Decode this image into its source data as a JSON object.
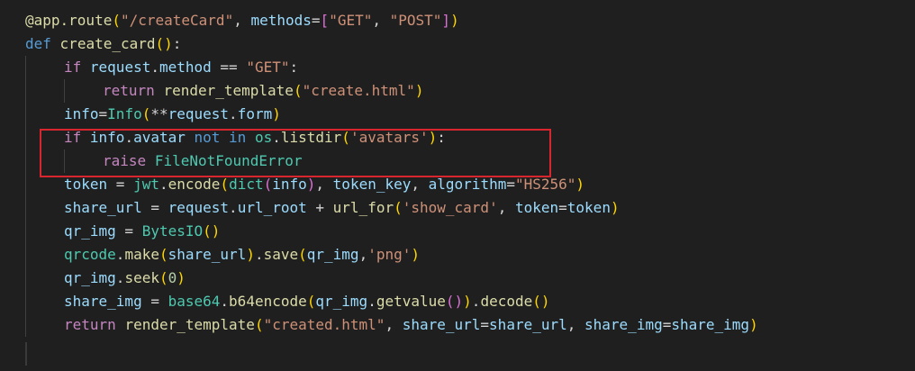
{
  "colors": {
    "background": "#1f1f1f",
    "highlight_box": "#d7262d",
    "default": "#d4d4d4",
    "keyword": "#569cd6",
    "control": "#c586c0",
    "function": "#dcdcaa",
    "string": "#ce9178",
    "variable": "#9cdcfe",
    "class": "#4ec9b0",
    "number": "#b5cea8",
    "bracket1": "#ffd700",
    "bracket2": "#da70d6",
    "bracket3": "#179fff"
  },
  "code_lines": [
    {
      "indent": 0,
      "tokens": [
        {
          "t": "@app.route",
          "c": "function"
        },
        {
          "t": "(",
          "c": "bracket1"
        },
        {
          "t": "\"/createCard\"",
          "c": "string"
        },
        {
          "t": ", ",
          "c": "default"
        },
        {
          "t": "methods",
          "c": "variable"
        },
        {
          "t": "=",
          "c": "default"
        },
        {
          "t": "[",
          "c": "bracket2"
        },
        {
          "t": "\"GET\"",
          "c": "string"
        },
        {
          "t": ", ",
          "c": "default"
        },
        {
          "t": "\"POST\"",
          "c": "string"
        },
        {
          "t": "]",
          "c": "bracket2"
        },
        {
          "t": ")",
          "c": "bracket1"
        }
      ]
    },
    {
      "indent": 0,
      "tokens": [
        {
          "t": "def",
          "c": "keyword"
        },
        {
          "t": " ",
          "c": "default"
        },
        {
          "t": "create_card",
          "c": "function"
        },
        {
          "t": "()",
          "c": "bracket1"
        },
        {
          "t": ":",
          "c": "default"
        }
      ]
    },
    {
      "indent": 1,
      "tokens": [
        {
          "t": "if",
          "c": "control"
        },
        {
          "t": " ",
          "c": "default"
        },
        {
          "t": "request",
          "c": "variable"
        },
        {
          "t": ".",
          "c": "default"
        },
        {
          "t": "method",
          "c": "variable"
        },
        {
          "t": " == ",
          "c": "default"
        },
        {
          "t": "\"GET\"",
          "c": "string"
        },
        {
          "t": ":",
          "c": "default"
        }
      ]
    },
    {
      "indent": 2,
      "tokens": [
        {
          "t": "return",
          "c": "control"
        },
        {
          "t": " ",
          "c": "default"
        },
        {
          "t": "render_template",
          "c": "function"
        },
        {
          "t": "(",
          "c": "bracket1"
        },
        {
          "t": "\"create.html\"",
          "c": "string"
        },
        {
          "t": ")",
          "c": "bracket1"
        }
      ]
    },
    {
      "indent": 1,
      "tokens": [
        {
          "t": "info",
          "c": "variable"
        },
        {
          "t": "=",
          "c": "default"
        },
        {
          "t": "Info",
          "c": "class"
        },
        {
          "t": "(",
          "c": "bracket1"
        },
        {
          "t": "**",
          "c": "default"
        },
        {
          "t": "request",
          "c": "variable"
        },
        {
          "t": ".",
          "c": "default"
        },
        {
          "t": "form",
          "c": "variable"
        },
        {
          "t": ")",
          "c": "bracket1"
        }
      ]
    },
    {
      "indent": 1,
      "tokens": [
        {
          "t": "if",
          "c": "control"
        },
        {
          "t": " ",
          "c": "default"
        },
        {
          "t": "info",
          "c": "variable"
        },
        {
          "t": ".",
          "c": "default"
        },
        {
          "t": "avatar",
          "c": "variable"
        },
        {
          "t": " ",
          "c": "default"
        },
        {
          "t": "not in",
          "c": "keyword"
        },
        {
          "t": " ",
          "c": "default"
        },
        {
          "t": "os",
          "c": "class"
        },
        {
          "t": ".",
          "c": "default"
        },
        {
          "t": "listdir",
          "c": "function"
        },
        {
          "t": "(",
          "c": "bracket1"
        },
        {
          "t": "'avatars'",
          "c": "string"
        },
        {
          "t": ")",
          "c": "bracket1"
        },
        {
          "t": ":",
          "c": "default"
        }
      ]
    },
    {
      "indent": 2,
      "tokens": [
        {
          "t": "raise",
          "c": "control"
        },
        {
          "t": " ",
          "c": "default"
        },
        {
          "t": "FileNotFoundError",
          "c": "class"
        }
      ]
    },
    {
      "indent": 1,
      "tokens": [
        {
          "t": "token",
          "c": "variable"
        },
        {
          "t": " = ",
          "c": "default"
        },
        {
          "t": "jwt",
          "c": "class"
        },
        {
          "t": ".",
          "c": "default"
        },
        {
          "t": "encode",
          "c": "function"
        },
        {
          "t": "(",
          "c": "bracket1"
        },
        {
          "t": "dict",
          "c": "class"
        },
        {
          "t": "(",
          "c": "bracket2"
        },
        {
          "t": "info",
          "c": "variable"
        },
        {
          "t": ")",
          "c": "bracket2"
        },
        {
          "t": ", ",
          "c": "default"
        },
        {
          "t": "token_key",
          "c": "variable"
        },
        {
          "t": ", ",
          "c": "default"
        },
        {
          "t": "algorithm",
          "c": "variable"
        },
        {
          "t": "=",
          "c": "default"
        },
        {
          "t": "\"HS256\"",
          "c": "string"
        },
        {
          "t": ")",
          "c": "bracket1"
        }
      ]
    },
    {
      "indent": 1,
      "tokens": [
        {
          "t": "share_url",
          "c": "variable"
        },
        {
          "t": " = ",
          "c": "default"
        },
        {
          "t": "request",
          "c": "variable"
        },
        {
          "t": ".",
          "c": "default"
        },
        {
          "t": "url_root",
          "c": "variable"
        },
        {
          "t": " + ",
          "c": "default"
        },
        {
          "t": "url_for",
          "c": "function"
        },
        {
          "t": "(",
          "c": "bracket1"
        },
        {
          "t": "'show_card'",
          "c": "string"
        },
        {
          "t": ", ",
          "c": "default"
        },
        {
          "t": "token",
          "c": "variable"
        },
        {
          "t": "=",
          "c": "default"
        },
        {
          "t": "token",
          "c": "variable"
        },
        {
          "t": ")",
          "c": "bracket1"
        }
      ]
    },
    {
      "indent": 1,
      "tokens": [
        {
          "t": "qr_img",
          "c": "variable"
        },
        {
          "t": " = ",
          "c": "default"
        },
        {
          "t": "BytesIO",
          "c": "class"
        },
        {
          "t": "()",
          "c": "bracket1"
        }
      ]
    },
    {
      "indent": 1,
      "tokens": [
        {
          "t": "qrcode",
          "c": "class"
        },
        {
          "t": ".",
          "c": "default"
        },
        {
          "t": "make",
          "c": "function"
        },
        {
          "t": "(",
          "c": "bracket1"
        },
        {
          "t": "share_url",
          "c": "variable"
        },
        {
          "t": ")",
          "c": "bracket1"
        },
        {
          "t": ".",
          "c": "default"
        },
        {
          "t": "save",
          "c": "function"
        },
        {
          "t": "(",
          "c": "bracket1"
        },
        {
          "t": "qr_img",
          "c": "variable"
        },
        {
          "t": ",",
          "c": "default"
        },
        {
          "t": "'png'",
          "c": "string"
        },
        {
          "t": ")",
          "c": "bracket1"
        }
      ]
    },
    {
      "indent": 1,
      "tokens": [
        {
          "t": "qr_img",
          "c": "variable"
        },
        {
          "t": ".",
          "c": "default"
        },
        {
          "t": "seek",
          "c": "function"
        },
        {
          "t": "(",
          "c": "bracket1"
        },
        {
          "t": "0",
          "c": "number"
        },
        {
          "t": ")",
          "c": "bracket1"
        }
      ]
    },
    {
      "indent": 1,
      "tokens": [
        {
          "t": "share_img",
          "c": "variable"
        },
        {
          "t": " = ",
          "c": "default"
        },
        {
          "t": "base64",
          "c": "class"
        },
        {
          "t": ".",
          "c": "default"
        },
        {
          "t": "b64encode",
          "c": "function"
        },
        {
          "t": "(",
          "c": "bracket1"
        },
        {
          "t": "qr_img",
          "c": "variable"
        },
        {
          "t": ".",
          "c": "default"
        },
        {
          "t": "getvalue",
          "c": "function"
        },
        {
          "t": "()",
          "c": "bracket2"
        },
        {
          "t": ")",
          "c": "bracket1"
        },
        {
          "t": ".",
          "c": "default"
        },
        {
          "t": "decode",
          "c": "function"
        },
        {
          "t": "()",
          "c": "bracket1"
        }
      ]
    },
    {
      "indent": 1,
      "tokens": [
        {
          "t": "return",
          "c": "control"
        },
        {
          "t": " ",
          "c": "default"
        },
        {
          "t": "render_template",
          "c": "function"
        },
        {
          "t": "(",
          "c": "bracket1"
        },
        {
          "t": "\"created.html\"",
          "c": "string"
        },
        {
          "t": ", ",
          "c": "default"
        },
        {
          "t": "share_url",
          "c": "variable"
        },
        {
          "t": "=",
          "c": "default"
        },
        {
          "t": "share_url",
          "c": "variable"
        },
        {
          "t": ", ",
          "c": "default"
        },
        {
          "t": "share_img",
          "c": "variable"
        },
        {
          "t": "=",
          "c": "default"
        },
        {
          "t": "share_img",
          "c": "variable"
        },
        {
          "t": ")",
          "c": "bracket1"
        }
      ]
    }
  ]
}
